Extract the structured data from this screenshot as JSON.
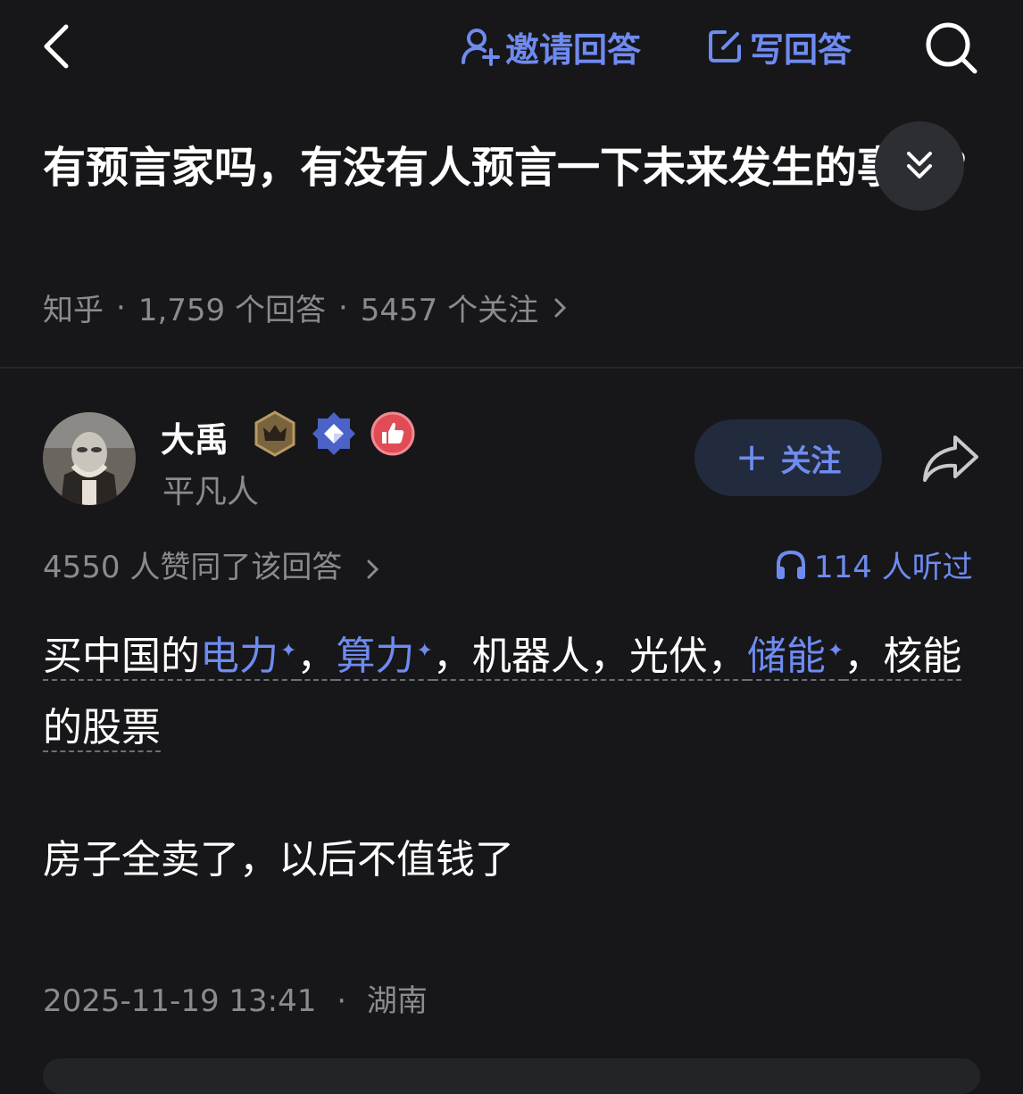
{
  "topbar": {
    "invite_label": "邀请回答",
    "write_label": "写回答"
  },
  "question": {
    "title": "有预言家吗，有没有人预言一下未来发生的事情?",
    "source": "知乎",
    "answers_count": "1,759 个回答",
    "followers_count": "5457 个关注"
  },
  "author": {
    "name": "大禹",
    "bio": "平凡人",
    "follow_label": "关注"
  },
  "answer": {
    "votes": "4550 人赞同了该回答",
    "listens": "114 人听过",
    "line1_prefix": "买中国的",
    "kw1": "电力",
    "sep1": "，",
    "kw2": "算力",
    "mid": "，机器人，光伏，",
    "kw3": "储能",
    "line_suffix": "，核能的股票",
    "paragraph2": "房子全卖了，以后不值钱了",
    "date": "2025-11-19 13:41",
    "location": "湖南"
  },
  "colors": {
    "background": "#17171a",
    "accent": "#6f8bf0",
    "muted": "#8a8b90"
  }
}
